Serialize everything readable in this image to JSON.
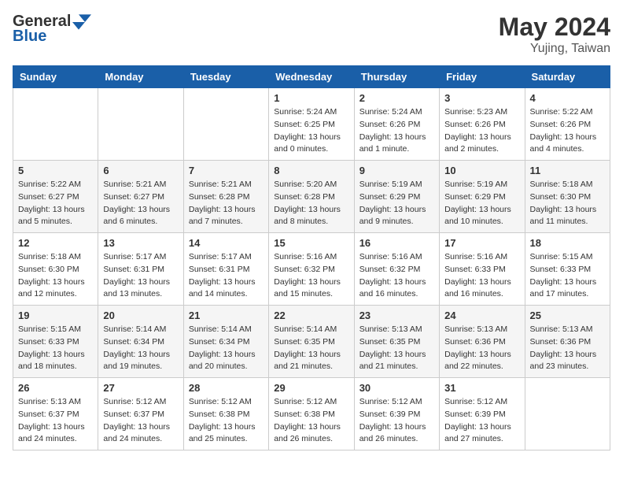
{
  "header": {
    "logo_general": "General",
    "logo_blue": "Blue",
    "month_year": "May 2024",
    "location": "Yujing, Taiwan"
  },
  "weekdays": [
    "Sunday",
    "Monday",
    "Tuesday",
    "Wednesday",
    "Thursday",
    "Friday",
    "Saturday"
  ],
  "weeks": [
    [
      {
        "day": "",
        "info": ""
      },
      {
        "day": "",
        "info": ""
      },
      {
        "day": "",
        "info": ""
      },
      {
        "day": "1",
        "info": "Sunrise: 5:24 AM\nSunset: 6:25 PM\nDaylight: 13 hours\nand 0 minutes."
      },
      {
        "day": "2",
        "info": "Sunrise: 5:24 AM\nSunset: 6:26 PM\nDaylight: 13 hours\nand 1 minute."
      },
      {
        "day": "3",
        "info": "Sunrise: 5:23 AM\nSunset: 6:26 PM\nDaylight: 13 hours\nand 2 minutes."
      },
      {
        "day": "4",
        "info": "Sunrise: 5:22 AM\nSunset: 6:26 PM\nDaylight: 13 hours\nand 4 minutes."
      }
    ],
    [
      {
        "day": "5",
        "info": "Sunrise: 5:22 AM\nSunset: 6:27 PM\nDaylight: 13 hours\nand 5 minutes."
      },
      {
        "day": "6",
        "info": "Sunrise: 5:21 AM\nSunset: 6:27 PM\nDaylight: 13 hours\nand 6 minutes."
      },
      {
        "day": "7",
        "info": "Sunrise: 5:21 AM\nSunset: 6:28 PM\nDaylight: 13 hours\nand 7 minutes."
      },
      {
        "day": "8",
        "info": "Sunrise: 5:20 AM\nSunset: 6:28 PM\nDaylight: 13 hours\nand 8 minutes."
      },
      {
        "day": "9",
        "info": "Sunrise: 5:19 AM\nSunset: 6:29 PM\nDaylight: 13 hours\nand 9 minutes."
      },
      {
        "day": "10",
        "info": "Sunrise: 5:19 AM\nSunset: 6:29 PM\nDaylight: 13 hours\nand 10 minutes."
      },
      {
        "day": "11",
        "info": "Sunrise: 5:18 AM\nSunset: 6:30 PM\nDaylight: 13 hours\nand 11 minutes."
      }
    ],
    [
      {
        "day": "12",
        "info": "Sunrise: 5:18 AM\nSunset: 6:30 PM\nDaylight: 13 hours\nand 12 minutes."
      },
      {
        "day": "13",
        "info": "Sunrise: 5:17 AM\nSunset: 6:31 PM\nDaylight: 13 hours\nand 13 minutes."
      },
      {
        "day": "14",
        "info": "Sunrise: 5:17 AM\nSunset: 6:31 PM\nDaylight: 13 hours\nand 14 minutes."
      },
      {
        "day": "15",
        "info": "Sunrise: 5:16 AM\nSunset: 6:32 PM\nDaylight: 13 hours\nand 15 minutes."
      },
      {
        "day": "16",
        "info": "Sunrise: 5:16 AM\nSunset: 6:32 PM\nDaylight: 13 hours\nand 16 minutes."
      },
      {
        "day": "17",
        "info": "Sunrise: 5:16 AM\nSunset: 6:33 PM\nDaylight: 13 hours\nand 16 minutes."
      },
      {
        "day": "18",
        "info": "Sunrise: 5:15 AM\nSunset: 6:33 PM\nDaylight: 13 hours\nand 17 minutes."
      }
    ],
    [
      {
        "day": "19",
        "info": "Sunrise: 5:15 AM\nSunset: 6:33 PM\nDaylight: 13 hours\nand 18 minutes."
      },
      {
        "day": "20",
        "info": "Sunrise: 5:14 AM\nSunset: 6:34 PM\nDaylight: 13 hours\nand 19 minutes."
      },
      {
        "day": "21",
        "info": "Sunrise: 5:14 AM\nSunset: 6:34 PM\nDaylight: 13 hours\nand 20 minutes."
      },
      {
        "day": "22",
        "info": "Sunrise: 5:14 AM\nSunset: 6:35 PM\nDaylight: 13 hours\nand 21 minutes."
      },
      {
        "day": "23",
        "info": "Sunrise: 5:13 AM\nSunset: 6:35 PM\nDaylight: 13 hours\nand 21 minutes."
      },
      {
        "day": "24",
        "info": "Sunrise: 5:13 AM\nSunset: 6:36 PM\nDaylight: 13 hours\nand 22 minutes."
      },
      {
        "day": "25",
        "info": "Sunrise: 5:13 AM\nSunset: 6:36 PM\nDaylight: 13 hours\nand 23 minutes."
      }
    ],
    [
      {
        "day": "26",
        "info": "Sunrise: 5:13 AM\nSunset: 6:37 PM\nDaylight: 13 hours\nand 24 minutes."
      },
      {
        "day": "27",
        "info": "Sunrise: 5:12 AM\nSunset: 6:37 PM\nDaylight: 13 hours\nand 24 minutes."
      },
      {
        "day": "28",
        "info": "Sunrise: 5:12 AM\nSunset: 6:38 PM\nDaylight: 13 hours\nand 25 minutes."
      },
      {
        "day": "29",
        "info": "Sunrise: 5:12 AM\nSunset: 6:38 PM\nDaylight: 13 hours\nand 26 minutes."
      },
      {
        "day": "30",
        "info": "Sunrise: 5:12 AM\nSunset: 6:39 PM\nDaylight: 13 hours\nand 26 minutes."
      },
      {
        "day": "31",
        "info": "Sunrise: 5:12 AM\nSunset: 6:39 PM\nDaylight: 13 hours\nand 27 minutes."
      },
      {
        "day": "",
        "info": ""
      }
    ]
  ]
}
